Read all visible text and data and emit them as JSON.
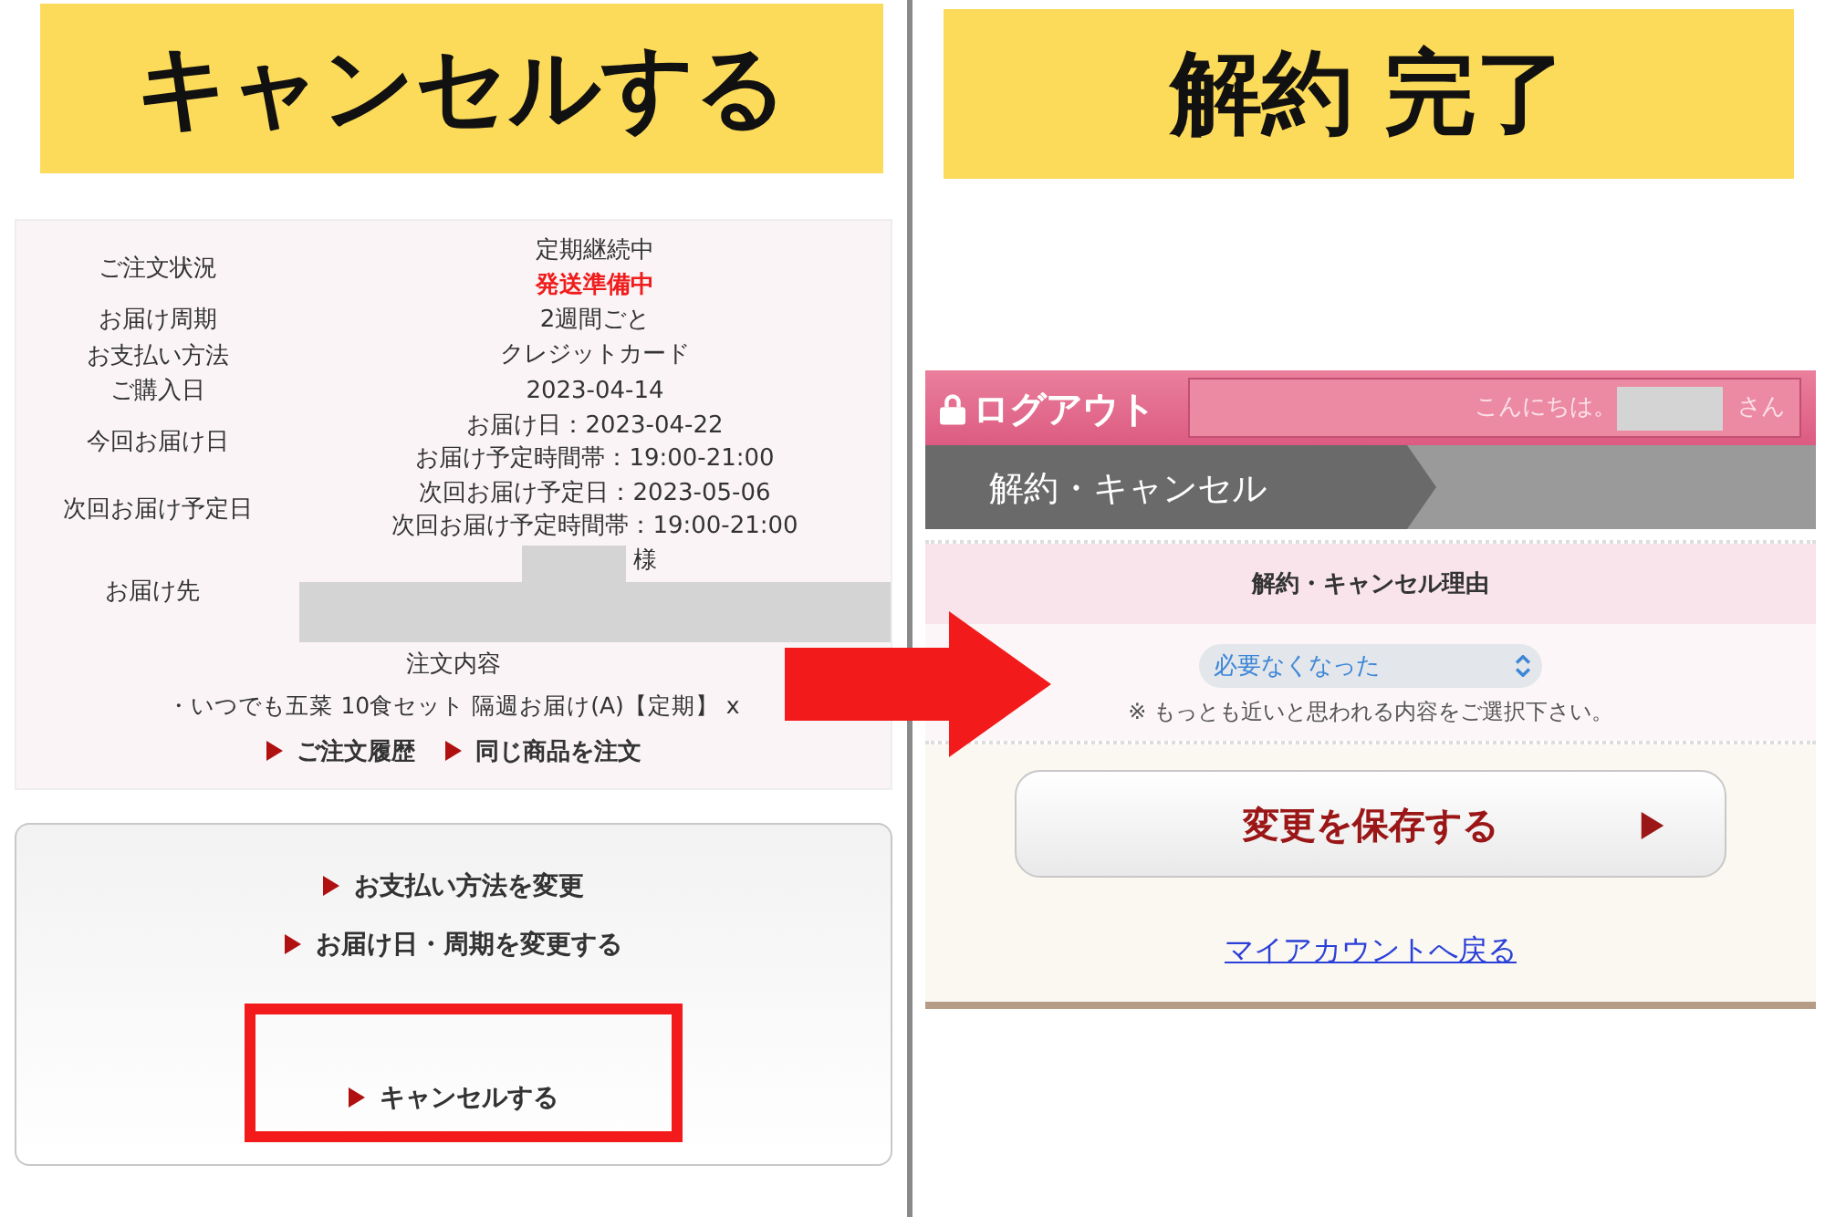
{
  "banners": [
    {
      "text": "キャンセルする"
    },
    {
      "text": "解約 完了"
    }
  ],
  "order": {
    "rows": [
      {
        "label": "ご注文状況",
        "kind": "lines",
        "values": [
          {
            "text": "定期継続中",
            "alert": false
          },
          {
            "text": "発送準備中",
            "alert": true
          }
        ]
      },
      {
        "label": "お届け周期",
        "kind": "lines",
        "values": [
          {
            "text": "2週間ごと",
            "alert": false
          }
        ]
      },
      {
        "label": "お支払い方法",
        "kind": "lines",
        "values": [
          {
            "text": "クレジットカード",
            "alert": false
          }
        ]
      },
      {
        "label": "ご購入日",
        "kind": "lines",
        "values": [
          {
            "text": "2023-04-14",
            "alert": false
          }
        ]
      },
      {
        "label": "今回お届け日",
        "kind": "lines",
        "values": [
          {
            "text": "お届け日：2023-04-22",
            "alert": false
          },
          {
            "text": "お届け予定時間帯：19:00-21:00",
            "alert": false
          }
        ]
      },
      {
        "label": "次回お届け予定日",
        "kind": "lines",
        "values": [
          {
            "text": "次回お届け予定日：2023-05-06",
            "alert": false
          },
          {
            "text": "次回お届け予定時間帯：19:00-21:00",
            "alert": false
          }
        ]
      },
      {
        "label": "お届け先",
        "kind": "address",
        "suffix": "様"
      }
    ],
    "contents_heading": "注文内容",
    "item": "・いつでも五菜 10食セット 隔週お届け(A)【定期】 x",
    "links": [
      "ご注文履歴",
      "同じ商品を注文"
    ]
  },
  "actions": [
    {
      "label": "お支払い方法を変更",
      "highlighted": false
    },
    {
      "label": "お届け日・周期を変更する",
      "highlighted": false
    },
    {
      "label": "キャンセルする",
      "highlighted": true
    }
  ],
  "cancel_page": {
    "logout": "ログアウト",
    "greeting": "こんにちは。",
    "honorific": "さん",
    "breadcrumb": "解約・キャンセル",
    "reason_heading": "解約・キャンセル理由",
    "reason_select": "必要なくなった",
    "note": "※ もっとも近いと思われる内容をご選択下さい。",
    "save_button": "変更を保存する",
    "back_link": "マイアカウントへ戻る"
  }
}
